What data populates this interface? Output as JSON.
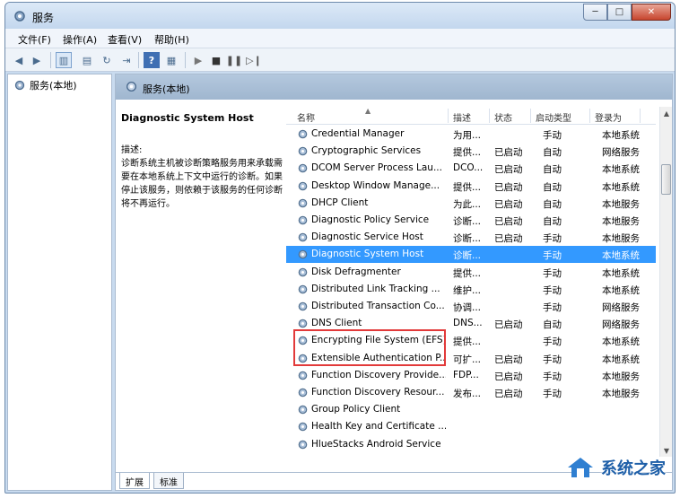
{
  "window": {
    "title": "服务",
    "buttons": {
      "minimize": "─",
      "maximize": "□",
      "close": "✕"
    }
  },
  "menu": [
    "文件(F)",
    "操作(A)",
    "查看(V)",
    "帮助(H)"
  ],
  "tree": {
    "root_label": "服务(本地)"
  },
  "panel": {
    "header": "服务(本地)"
  },
  "description": {
    "title": "Diagnostic System Host",
    "label": "描述:",
    "body": "诊断系统主机被诊断策略服务用来承载需要在本地系统上下文中运行的诊断。如果停止该服务，则依赖于该服务的任何诊断将不再运行。"
  },
  "columns": {
    "name": "名称",
    "desc": "描述",
    "status": "状态",
    "startup": "启动类型",
    "logon": "登录为"
  },
  "rows": [
    {
      "name": "Credential Manager",
      "desc": "为用...",
      "status": "",
      "startup": "手动",
      "logon": "本地系统"
    },
    {
      "name": "Cryptographic Services",
      "desc": "提供...",
      "status": "已启动",
      "startup": "自动",
      "logon": "网络服务"
    },
    {
      "name": "DCOM Server Process Lau...",
      "desc": "DCO...",
      "status": "已启动",
      "startup": "自动",
      "logon": "本地系统"
    },
    {
      "name": "Desktop Window Manage...",
      "desc": "提供...",
      "status": "已启动",
      "startup": "自动",
      "logon": "本地系统"
    },
    {
      "name": "DHCP Client",
      "desc": "为此...",
      "status": "已启动",
      "startup": "自动",
      "logon": "本地服务"
    },
    {
      "name": "Diagnostic Policy Service",
      "desc": "诊断...",
      "status": "已启动",
      "startup": "自动",
      "logon": "本地服务"
    },
    {
      "name": "Diagnostic Service Host",
      "desc": "诊断...",
      "status": "已启动",
      "startup": "手动",
      "logon": "本地服务"
    },
    {
      "name": "Diagnostic System Host",
      "desc": "诊断...",
      "status": "",
      "startup": "手动",
      "logon": "本地系统",
      "selected": true
    },
    {
      "name": "Disk Defragmenter",
      "desc": "提供...",
      "status": "",
      "startup": "手动",
      "logon": "本地系统"
    },
    {
      "name": "Distributed Link Tracking ...",
      "desc": "维护...",
      "status": "",
      "startup": "手动",
      "logon": "本地系统"
    },
    {
      "name": "Distributed Transaction Co...",
      "desc": "协调...",
      "status": "",
      "startup": "手动",
      "logon": "网络服务"
    },
    {
      "name": "DNS Client",
      "desc": "DNS...",
      "status": "已启动",
      "startup": "自动",
      "logon": "网络服务"
    },
    {
      "name": "Encrypting File System (EFS)",
      "desc": "提供...",
      "status": "",
      "startup": "手动",
      "logon": "本地系统"
    },
    {
      "name": "Extensible Authentication P...",
      "desc": "可扩...",
      "status": "已启动",
      "startup": "手动",
      "logon": "本地系统"
    },
    {
      "name": "Function Discovery Provide...",
      "desc": "FDP...",
      "status": "已启动",
      "startup": "手动",
      "logon": "本地服务"
    },
    {
      "name": "Function Discovery Resour...",
      "desc": "发布...",
      "status": "已启动",
      "startup": "手动",
      "logon": "本地服务"
    },
    {
      "name": "Group Policy Client",
      "desc": "",
      "status": "",
      "startup": "",
      "logon": ""
    },
    {
      "name": "Health Key and Certificate ...",
      "desc": "",
      "status": "",
      "startup": "",
      "logon": ""
    },
    {
      "name": "HlueStacks Android Service",
      "desc": "",
      "status": "",
      "startup": "",
      "logon": ""
    }
  ],
  "tabs": [
    "扩展",
    "标准"
  ],
  "watermark": "系统之家",
  "colors": {
    "selection": "#3399ff",
    "highlight_box": "#e23a3a"
  }
}
